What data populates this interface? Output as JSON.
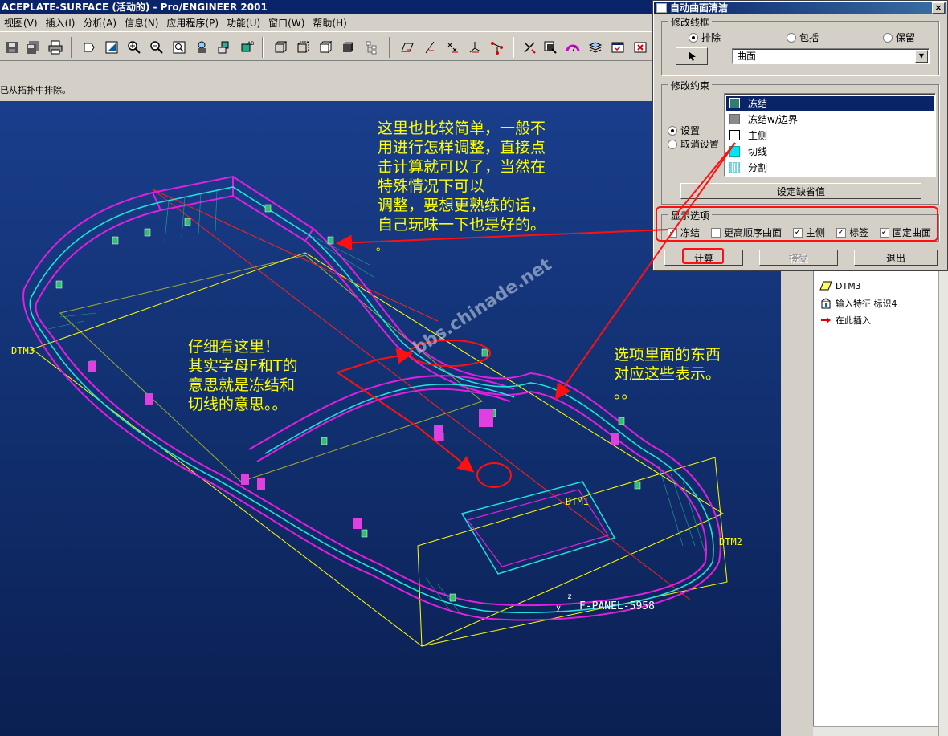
{
  "app": {
    "title": "ACEPLATE-SURFACE (活动的) - Pro/ENGINEER 2001",
    "menu": [
      "视图(V)",
      "插入(I)",
      "分析(A)",
      "信息(N)",
      "应用程序(P)",
      "功能(U)",
      "窗口(W)",
      "帮助(H)"
    ],
    "message": "已从拓扑中排除。"
  },
  "dialog": {
    "title": "自动曲面清洁",
    "close_label": "×",
    "modify_frame": {
      "label": "修改线框",
      "options": [
        "排除",
        "包括",
        "保留"
      ],
      "selected": "排除",
      "select_value": "曲面"
    },
    "modify_constraint": {
      "label": "修改约束",
      "options": [
        "设置",
        "取消设置"
      ],
      "selected": "设置",
      "list": [
        {
          "label": "冻结",
          "color": "#2e7d6e"
        },
        {
          "label": "冻结w/边界",
          "color": "#8a8a8a"
        },
        {
          "label": "主侧",
          "color": "#ffffff"
        },
        {
          "label": "切线",
          "color": "#00e5f0"
        },
        {
          "label": "分割",
          "color": "#7fd8e0"
        }
      ],
      "default_button": "设定缺省值"
    },
    "display_options": {
      "label": "显示选项",
      "items": [
        {
          "label": "冻结",
          "checked": true
        },
        {
          "label": "更高顺序曲面",
          "checked": false
        },
        {
          "label": "主侧",
          "checked": true
        },
        {
          "label": "标签",
          "checked": true
        },
        {
          "label": "固定曲面",
          "checked": true
        }
      ]
    },
    "buttons": {
      "compute": "计算",
      "accept": "接受",
      "exit": "退出"
    }
  },
  "model_tree": [
    {
      "label": "DTM3",
      "icon": "datum-plane-icon"
    },
    {
      "label": "输入特征 标识4",
      "icon": "import-feature-icon"
    },
    {
      "label": "在此插入",
      "icon": "insert-here-arrow-icon"
    }
  ],
  "cad_labels": {
    "dtm3": "DTM3",
    "dtm1": "DTM1",
    "dtm2": "DTM2",
    "csys": "F-PANEL-5958",
    "axis_z": "z",
    "axis_y": "y"
  },
  "annotations": {
    "a1": [
      "这里也比较简单，一般不",
      "用进行怎样调整，直接点",
      "击计算就可以了，当然在",
      "特殊情况下可以",
      "调整，要想更熟练的话，",
      "自己玩味一下也是好的。"
    ],
    "a1_tail": "。",
    "a2": [
      "仔细看这里！",
      "其实字母F和T的",
      "意思就是冻结和",
      "切线的意思。。"
    ],
    "a3": [
      "选项里面的东西",
      "对应这些表示。",
      "。。"
    ]
  },
  "watermark": "bbs.chinade.net",
  "colors": {
    "accent_red": "#ff1010",
    "annotation": "#ffff00",
    "wire_magenta": "#e020e0",
    "wire_cyan": "#20e0e0"
  }
}
